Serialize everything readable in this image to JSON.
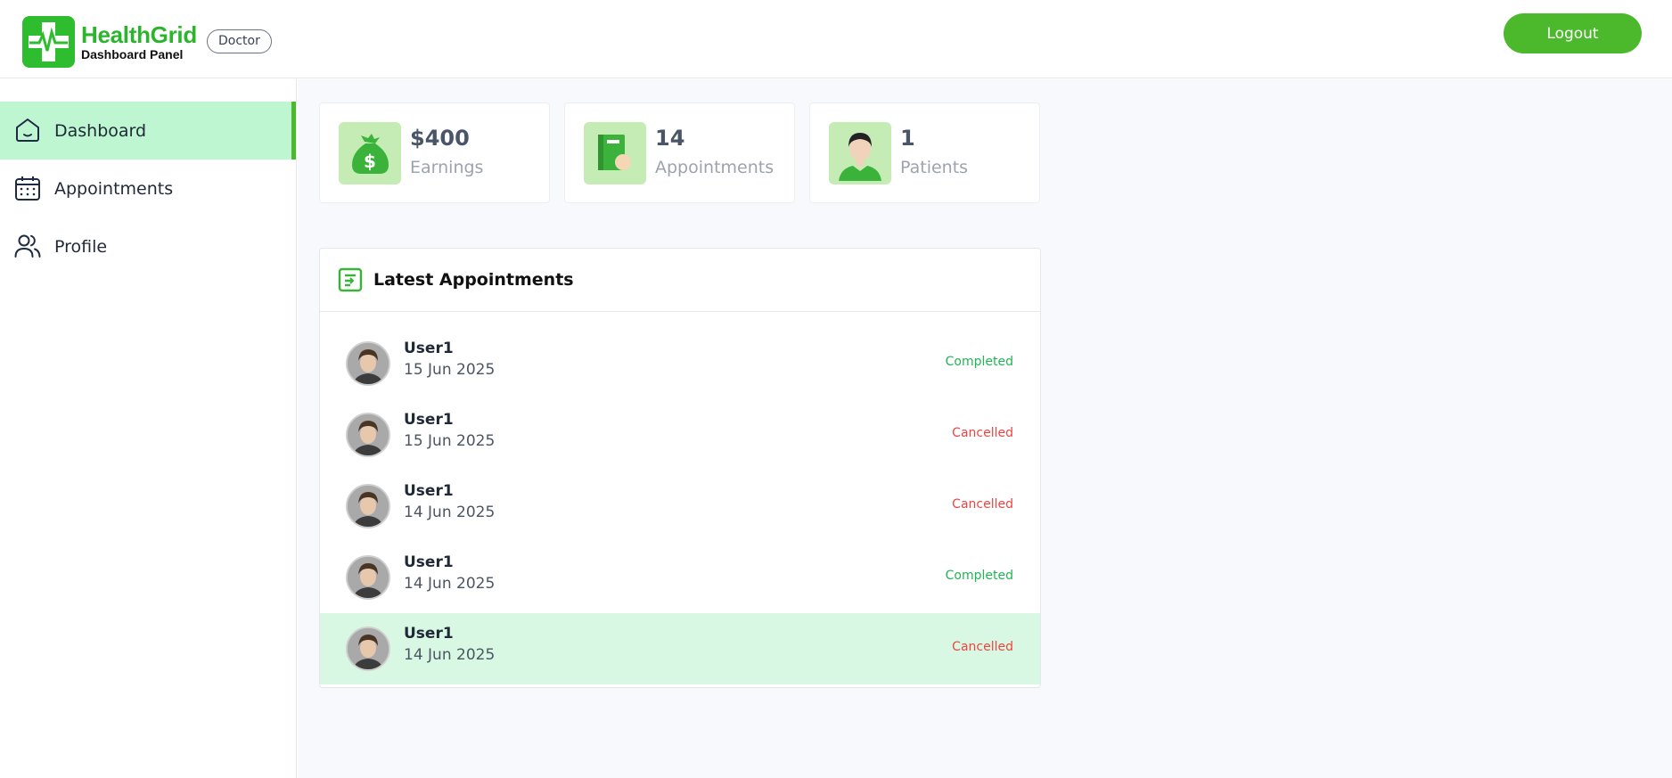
{
  "header": {
    "brand_title": "HealthGrid",
    "brand_subtitle": "Dashboard Panel",
    "role_badge": "Doctor",
    "logout_label": "Logout"
  },
  "sidebar": {
    "items": [
      {
        "label": "Dashboard",
        "icon": "home-icon",
        "active": true
      },
      {
        "label": "Appointments",
        "icon": "calendar-icon",
        "active": false
      },
      {
        "label": "Profile",
        "icon": "users-icon",
        "active": false
      }
    ]
  },
  "stats": [
    {
      "value": "$400",
      "label": "Earnings",
      "icon": "money-bag-icon"
    },
    {
      "value": "14",
      "label": "Appointments",
      "icon": "appointment-book-icon"
    },
    {
      "value": "1",
      "label": "Patients",
      "icon": "patient-icon"
    }
  ],
  "latest": {
    "title": "Latest Appointments",
    "icon": "list-icon",
    "rows": [
      {
        "name": "User1",
        "date": "15 Jun 2025",
        "status": "Completed"
      },
      {
        "name": "User1",
        "date": "15 Jun 2025",
        "status": "Cancelled"
      },
      {
        "name": "User1",
        "date": "14 Jun 2025",
        "status": "Cancelled"
      },
      {
        "name": "User1",
        "date": "14 Jun 2025",
        "status": "Completed"
      },
      {
        "name": "User1",
        "date": "14 Jun 2025",
        "status": "Cancelled"
      }
    ]
  },
  "colors": {
    "brand_green": "#2cb52c",
    "logout_green": "#4cb82c",
    "active_nav_bg": "#bdf6d0",
    "completed": "#22b455",
    "cancelled": "#ef4444",
    "highlight_row": "#d9f8e3"
  }
}
